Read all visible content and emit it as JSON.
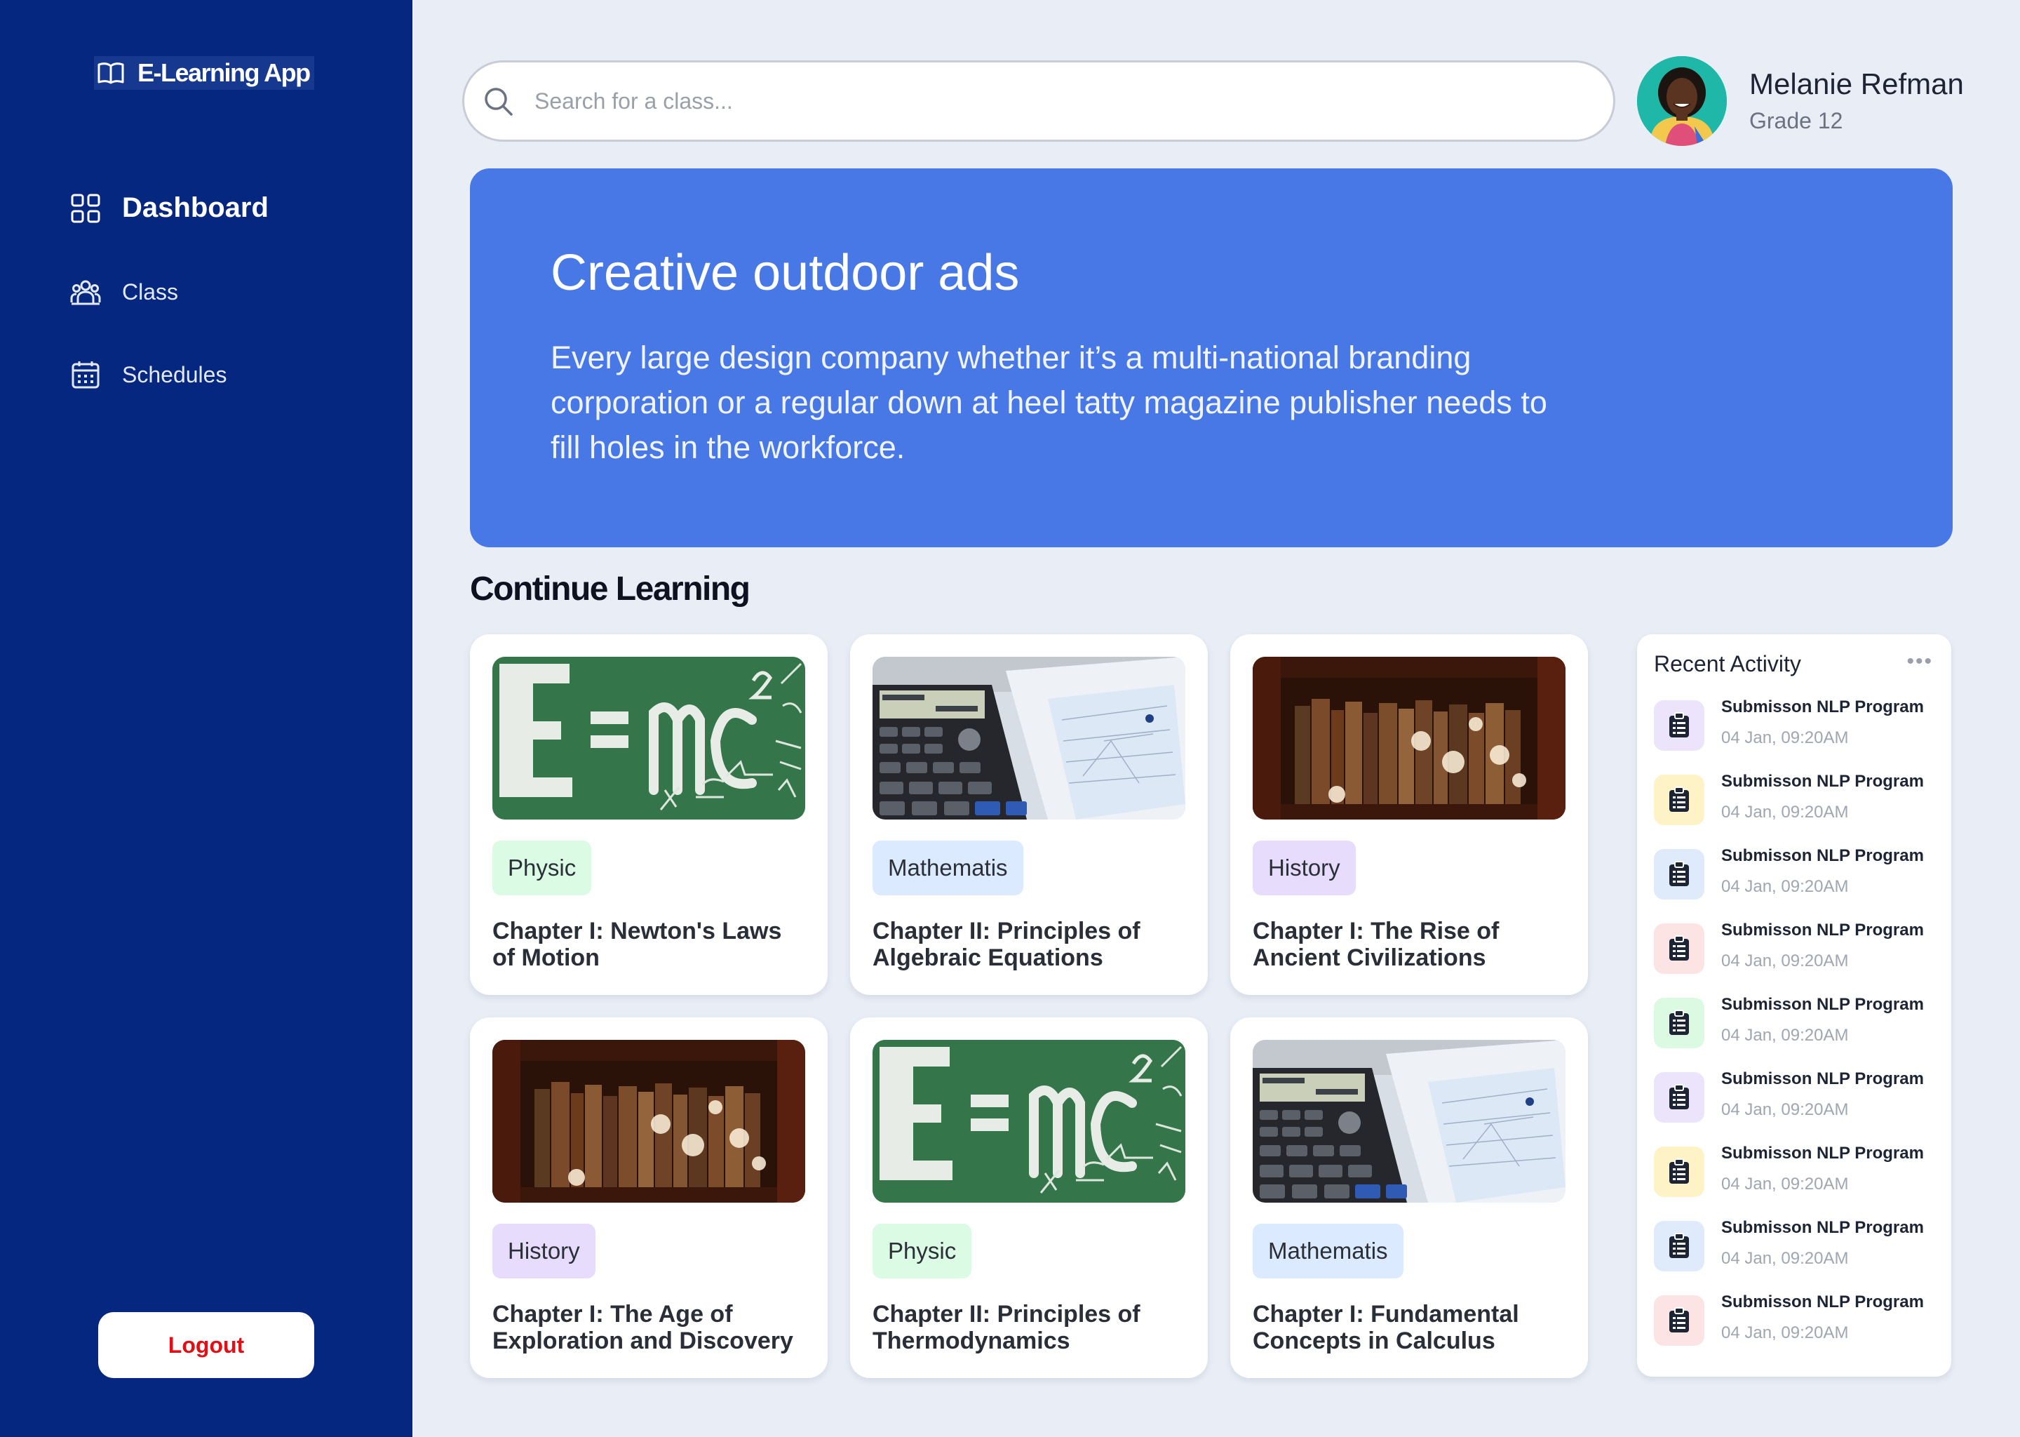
{
  "app": {
    "name": "E-Learning App"
  },
  "nav": {
    "items": [
      {
        "label": "Dashboard",
        "icon": "grid-icon"
      },
      {
        "label": "Class",
        "icon": "users-icon"
      },
      {
        "label": "Schedules",
        "icon": "calendar-icon"
      }
    ],
    "logout_label": "Logout"
  },
  "search": {
    "placeholder": "Search for a class..."
  },
  "user": {
    "name": "Melanie Refman",
    "grade": "Grade 12"
  },
  "hero": {
    "title": "Creative outdoor ads",
    "body": "Every large design company whether it’s a multi-national branding corporation or a regular down at heel tatty magazine publisher needs to fill holes in the workforce."
  },
  "section": {
    "title": "Continue Learning"
  },
  "courses": [
    {
      "tag": "Physic",
      "title": "Chapter I: Newton's Laws of Motion",
      "image": "chalkboard-formula"
    },
    {
      "tag": "Mathematis",
      "title": "Chapter II: Principles of Algebraic Equations",
      "image": "calculator"
    },
    {
      "tag": "History",
      "title": "Chapter I: The Rise of Ancient Civilizations",
      "image": "bookshelf"
    },
    {
      "tag": "History",
      "title": "Chapter I: The Age of Exploration and Discovery",
      "image": "bookshelf"
    },
    {
      "tag": "Physic",
      "title": "Chapter II: Principles of Thermodynamics",
      "image": "chalkboard-formula"
    },
    {
      "tag": "Mathematis",
      "title": "Chapter I: Fundamental Concepts in Calculus",
      "image": "calculator"
    }
  ],
  "activity": {
    "title": "Recent Activity",
    "more": "•••",
    "items": [
      {
        "title": "Submisson NLP Program",
        "date": "04 Jan, 09:20AM",
        "color": "#ece4fb"
      },
      {
        "title": "Submisson NLP Program",
        "date": "04 Jan, 09:20AM",
        "color": "#fdf3c7"
      },
      {
        "title": "Submisson NLP Program",
        "date": "04 Jan, 09:20AM",
        "color": "#dfeafb"
      },
      {
        "title": "Submisson NLP Program",
        "date": "04 Jan, 09:20AM",
        "color": "#fde4e4"
      },
      {
        "title": "Submisson NLP Program",
        "date": "04 Jan, 09:20AM",
        "color": "#dcf9e2"
      },
      {
        "title": "Submisson NLP Program",
        "date": "04 Jan, 09:20AM",
        "color": "#ece4fb"
      },
      {
        "title": "Submisson NLP Program",
        "date": "04 Jan, 09:20AM",
        "color": "#fdf3c7"
      },
      {
        "title": "Submisson NLP Program",
        "date": "04 Jan, 09:20AM",
        "color": "#dfeafb"
      },
      {
        "title": "Submisson NLP Program",
        "date": "04 Jan, 09:20AM",
        "color": "#fde4e4"
      }
    ]
  },
  "colors": {
    "sidebar": "#062780",
    "hero": "#4878e6",
    "logout": "#e10f16"
  }
}
